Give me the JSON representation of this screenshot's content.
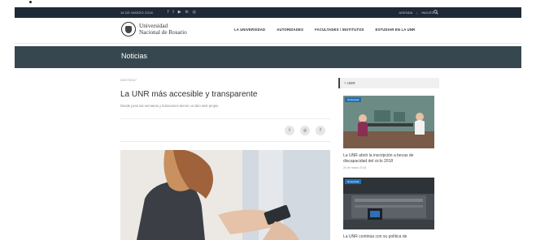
{
  "topbar": {
    "date": "16 DE MARZO 2018",
    "socials": [
      "f",
      "t",
      "▶",
      "in",
      "◎"
    ],
    "links": [
      "AGENDA",
      "INGLÉS"
    ]
  },
  "header": {
    "logo_line1": "Universidad",
    "logo_line2": "Nacional de Rosario",
    "nav": [
      "LA UNIVERSIDAD",
      "AUTORIDADES",
      "FACULTADES / INSTITUTOS",
      "ESTUDIAR EN LA UNR"
    ]
  },
  "section": {
    "title": "Noticias"
  },
  "article": {
    "date": "26/07/2017",
    "title": "La UNR más accesible y transparente",
    "subtitle": "Desde junio las semanas y licitaciones tienen un sitio web propio",
    "share_icons": [
      "twitter-icon",
      "instagram-icon",
      "facebook-icon"
    ],
    "share_glyphs": [
      "t",
      "◎",
      "f"
    ]
  },
  "sidebar": {
    "heading": "+ UNR",
    "cards": [
      {
        "tag": "Destacada",
        "caption": "La UNR abrió la inscripción a becas de discapacidad del ciclo 2018",
        "meta": "26 de marzo 2018"
      },
      {
        "tag": "Destacada",
        "caption": "La UNR continúa con su política de",
        "meta": ""
      }
    ]
  }
}
